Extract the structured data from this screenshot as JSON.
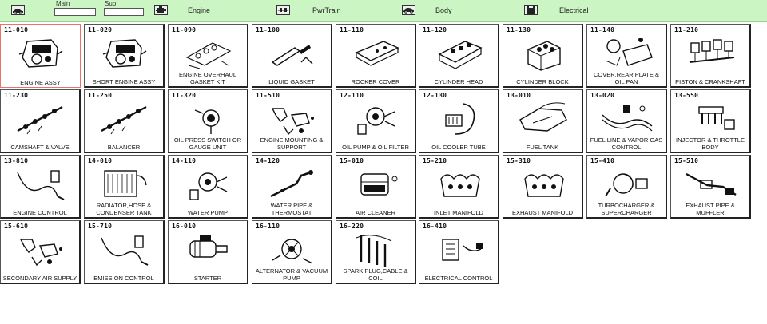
{
  "toolbar": {
    "main_label": "Main",
    "main_value": "",
    "sub_label": "Sub",
    "sub_value": "",
    "tabs": [
      {
        "label": "Engine",
        "icon": "engine-icon"
      },
      {
        "label": "PwrTrain",
        "icon": "powertrain-icon"
      },
      {
        "label": "Body",
        "icon": "car-body-icon"
      },
      {
        "label": "Electrical",
        "icon": "battery-icon"
      }
    ]
  },
  "colors": {
    "toolbar_bg": "#ccf5c4",
    "selected_border": "#e8736a"
  },
  "parts": [
    {
      "code": "11-010",
      "name": "ENGINE ASSY",
      "art": "engine",
      "selected": true
    },
    {
      "code": "11-020",
      "name": "SHORT ENGINE ASSY",
      "art": "engine"
    },
    {
      "code": "11-090",
      "name": "ENGINE OVERHAUL GASKET KIT",
      "art": "gasket"
    },
    {
      "code": "11-100",
      "name": "LIQUID GASKET",
      "art": "tube"
    },
    {
      "code": "11-110",
      "name": "ROCKER COVER",
      "art": "cover"
    },
    {
      "code": "11-120",
      "name": "CYLINDER HEAD",
      "art": "head"
    },
    {
      "code": "11-130",
      "name": "CYLINDER BLOCK",
      "art": "block"
    },
    {
      "code": "11-140",
      "name": "COVER,REAR PLATE & OIL PAN",
      "art": "pan"
    },
    {
      "code": "11-210",
      "name": "PISTON & CRANKSHAFT",
      "art": "piston"
    },
    {
      "code": "11-230",
      "name": "CAMSHAFT & VALVE",
      "art": "shaft"
    },
    {
      "code": "11-250",
      "name": "BALANCER",
      "art": "shaft"
    },
    {
      "code": "11-320",
      "name": "OIL PRESS SWITCH OR GAUGE UNIT",
      "art": "switch"
    },
    {
      "code": "11-510",
      "name": "ENGINE MOUNTING & SUPPORT",
      "art": "bracket"
    },
    {
      "code": "12-110",
      "name": "OIL PUMP & OIL FILTER",
      "art": "pump"
    },
    {
      "code": "12-130",
      "name": "OIL COOLER TUBE",
      "art": "cooler"
    },
    {
      "code": "13-010",
      "name": "FUEL TANK",
      "art": "tank"
    },
    {
      "code": "13-020",
      "name": "FUEL LINE & VAPOR GAS CONTROL",
      "art": "lines"
    },
    {
      "code": "13-550",
      "name": "INJECTOR & THROTTLE BODY",
      "art": "injector"
    },
    {
      "code": "13-810",
      "name": "ENGINE CONTROL",
      "art": "cable"
    },
    {
      "code": "14-010",
      "name": "RADIATOR,HOSE & CONDENSER TANK",
      "art": "radiator"
    },
    {
      "code": "14-110",
      "name": "WATER PUMP",
      "art": "pump"
    },
    {
      "code": "14-120",
      "name": "WATER PIPE & THERMOSTAT",
      "art": "pipe"
    },
    {
      "code": "15-010",
      "name": "AIR CLEANER",
      "art": "cleaner"
    },
    {
      "code": "15-210",
      "name": "INLET MANIFOLD",
      "art": "manifold"
    },
    {
      "code": "15-310",
      "name": "EXHAUST MANIFOLD",
      "art": "manifold"
    },
    {
      "code": "15-410",
      "name": "TURBOCHARGER & SUPERCHARGER",
      "art": "turbo"
    },
    {
      "code": "15-510",
      "name": "EXHAUST PIPE & MUFFLER",
      "art": "exhaust"
    },
    {
      "code": "15-610",
      "name": "SECONDARY AIR SUPPLY",
      "art": "bracket"
    },
    {
      "code": "15-710",
      "name": "EMISSION CONTROL",
      "art": "cable"
    },
    {
      "code": "16-010",
      "name": "STARTER",
      "art": "starter"
    },
    {
      "code": "16-110",
      "name": "ALTERNATOR & VACUUM PUMP",
      "art": "alternator"
    },
    {
      "code": "16-220",
      "name": "SPARK PLUG,CABLE & COIL",
      "art": "plugs"
    },
    {
      "code": "16-410",
      "name": "ELECTRICAL CONTROL",
      "art": "ecu"
    }
  ]
}
